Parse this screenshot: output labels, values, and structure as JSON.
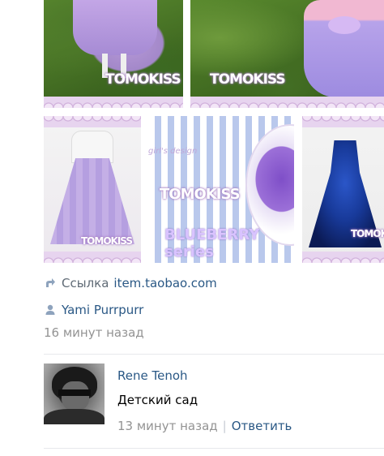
{
  "photos": [
    {
      "watermark": "TOMOKISS"
    },
    {
      "watermark": "TOMOKISS"
    },
    {
      "watermark": "TOMOKISS"
    },
    {
      "watermark": "TOMOKISS",
      "script": "girl's design",
      "series": "BLUEBERRY series"
    },
    {
      "watermark": "TOMOKISS"
    }
  ],
  "post": {
    "link_label": "Ссылка",
    "link_url": "item.taobao.com",
    "author": "Yami Purrpurr",
    "time": "16 минут назад"
  },
  "comment": {
    "author": "Rene Tenoh",
    "text": "Детский сад",
    "time": "13 минут назад",
    "separator": "|",
    "reply_label": "Ответить"
  },
  "colors": {
    "link": "#2a5885",
    "muted": "#939393",
    "divider": "#e7e8ec"
  },
  "icons": {
    "link": "arrow-share-icon",
    "author": "user-icon"
  }
}
